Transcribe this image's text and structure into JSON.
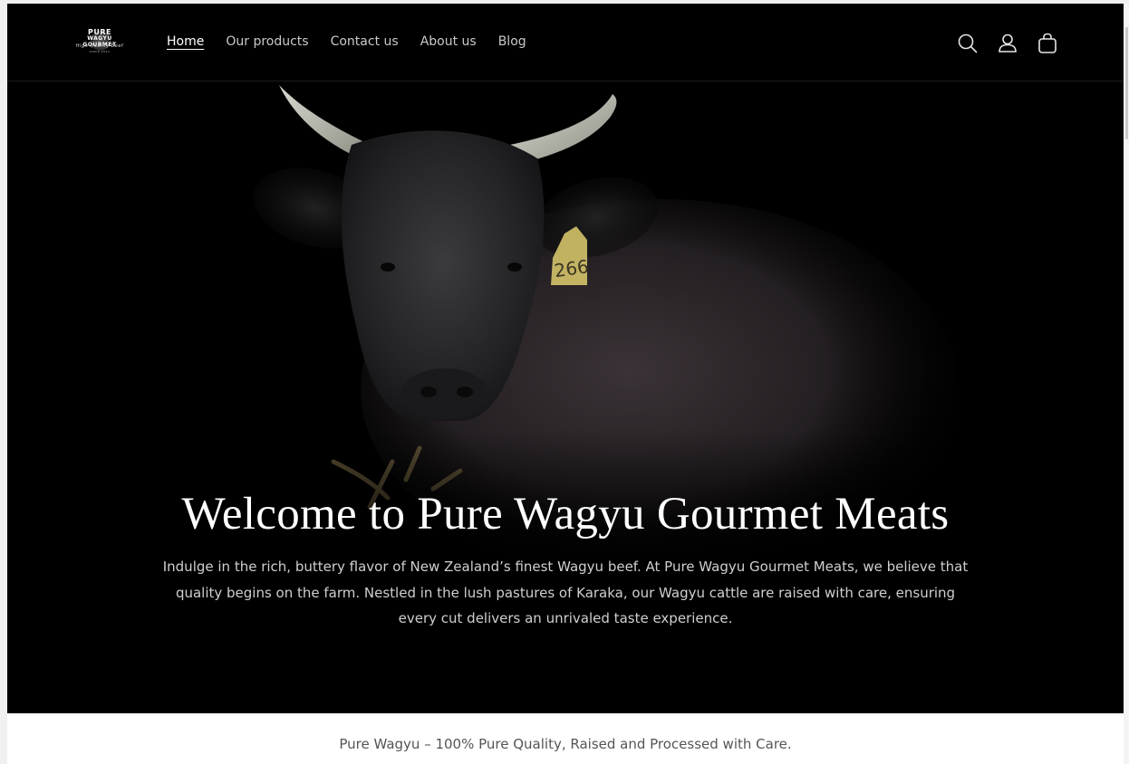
{
  "header": {
    "logo": {
      "line1": "PURE",
      "line2": "WAGYU GOURMET",
      "line3": "High Quality Beef",
      "line4": "SINCE 2023"
    },
    "nav": [
      {
        "label": "Home",
        "active": true
      },
      {
        "label": "Our products",
        "active": false
      },
      {
        "label": "Contact us",
        "active": false
      },
      {
        "label": "About us",
        "active": false
      },
      {
        "label": "Blog",
        "active": false
      }
    ],
    "icons": [
      "search-icon",
      "account-icon",
      "cart-icon"
    ]
  },
  "hero": {
    "ear_tag": "266",
    "title": "Welcome to Pure Wagyu Gourmet Meats",
    "text": "Indulge in the rich, buttery flavor of New Zealand’s finest Wagyu beef. At Pure Wagyu Gourmet Meats, we believe that quality begins on the farm. Nestled in the lush pastures of Karaka, our Wagyu cattle are raised with care, ensuring every cut delivers an unrivaled taste experience."
  },
  "announcement": {
    "text": "Pure Wagyu – 100% Pure Quality, Raised and Processed with Care."
  },
  "colors": {
    "background": "#000000",
    "text_primary": "#ffffff",
    "text_secondary": "#cfcfcf",
    "band_background": "#ffffff"
  }
}
